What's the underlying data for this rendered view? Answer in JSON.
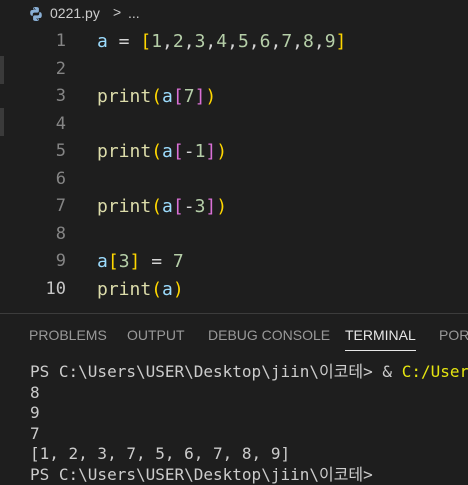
{
  "breadcrumb": {
    "file_name": "0221.py",
    "separator": ">",
    "ellipsis": "..."
  },
  "editor": {
    "lines": [
      {
        "number": "1",
        "code": "a = [1,2,3,4,5,6,7,8,9]"
      },
      {
        "number": "2",
        "code": ""
      },
      {
        "number": "3",
        "code": "print(a[7])"
      },
      {
        "number": "4",
        "code": ""
      },
      {
        "number": "5",
        "code": "print(a[-1])"
      },
      {
        "number": "6",
        "code": ""
      },
      {
        "number": "7",
        "code": "print(a[-3])"
      },
      {
        "number": "8",
        "code": ""
      },
      {
        "number": "9",
        "code": "a[3] = 7"
      },
      {
        "number": "10",
        "code": "print(a)"
      }
    ],
    "current_line": "10"
  },
  "panel": {
    "tabs": [
      "PROBLEMS",
      "OUTPUT",
      "DEBUG CONSOLE",
      "TERMINAL",
      "PORTS"
    ],
    "active_tab": "TERMINAL"
  },
  "terminal": {
    "prompt": "PS C:\\Users\\USER\\Desktop\\jiin\\이코테> & ",
    "command_path": "C:/Users/",
    "output_lines": [
      "8",
      "9",
      "7",
      "[1, 2, 3, 7, 5, 6, 7, 8, 9]"
    ],
    "partial_prompt": "PS C:\\Users\\USER\\Desktop\\jiin\\이코테> "
  },
  "colors": {
    "keyword_var": "#9cdcfe",
    "function": "#dcdcaa",
    "number": "#b5cea8",
    "bracket1": "#ffd700",
    "bracket2": "#da70d6",
    "background": "#1e1e1e"
  },
  "icons": {
    "file": "python-file-icon",
    "chevron": "chevron-right-icon"
  }
}
